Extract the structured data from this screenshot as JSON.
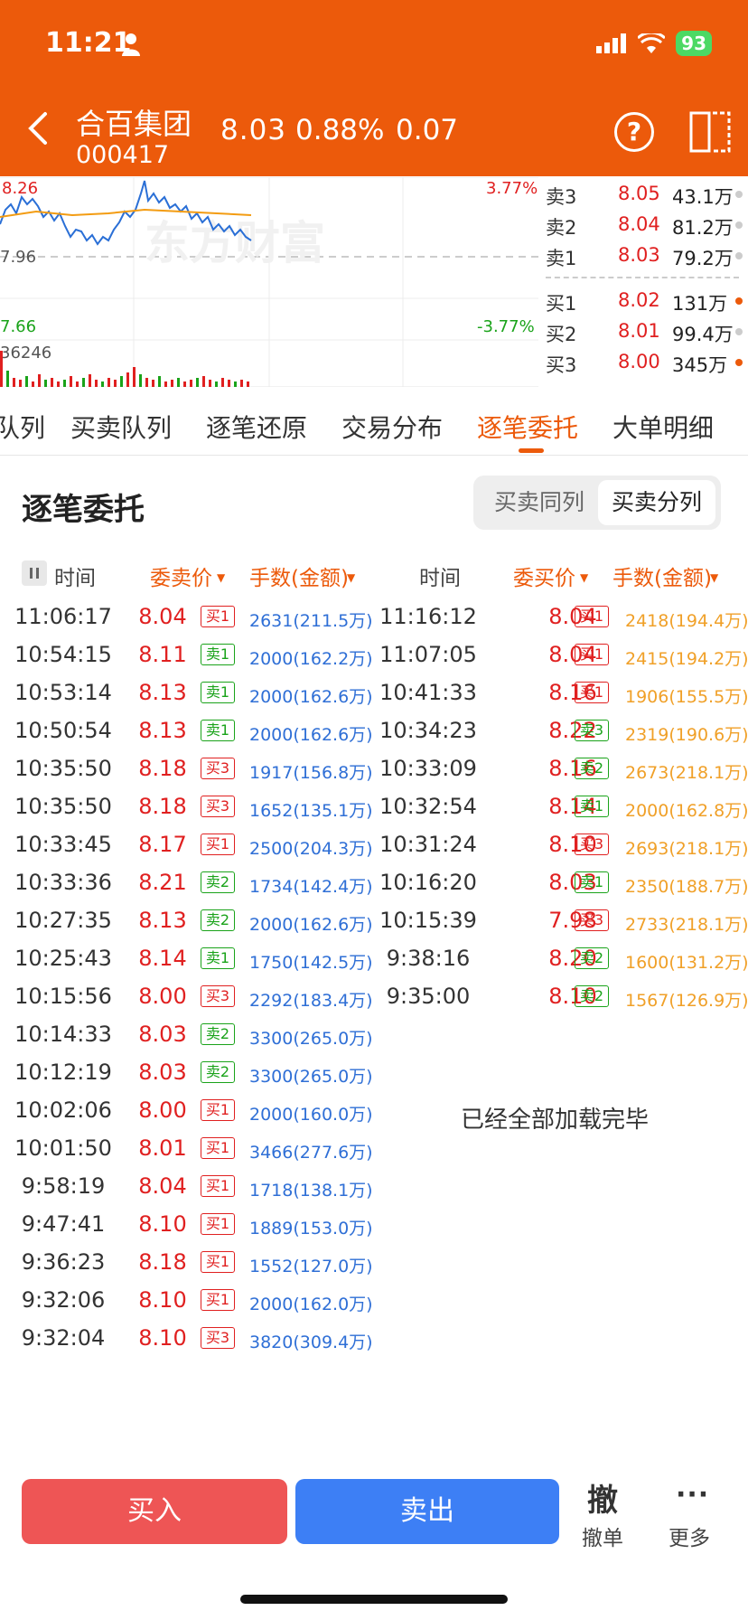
{
  "status": {
    "time": "11:21",
    "battery": "93"
  },
  "stock": {
    "name": "合百集团",
    "code": "000417",
    "price": "8.03",
    "pct": "0.88%",
    "change": "0.07"
  },
  "chart": {
    "high_label": "8.26",
    "mid_label": "7.96",
    "low_label": "7.66",
    "up_pct": "3.77%",
    "down_pct": "-3.77%",
    "volume_label": "36246",
    "watermark": "东方财富"
  },
  "depth": {
    "sells": [
      {
        "label": "卖3",
        "price": "8.05",
        "volume": "43.1万"
      },
      {
        "label": "卖2",
        "price": "8.04",
        "volume": "81.2万"
      },
      {
        "label": "卖1",
        "price": "8.03",
        "volume": "79.2万"
      }
    ],
    "buys": [
      {
        "label": "买1",
        "price": "8.02",
        "volume": "131万"
      },
      {
        "label": "买2",
        "price": "8.01",
        "volume": "99.4万"
      },
      {
        "label": "买3",
        "price": "8.00",
        "volume": "345万"
      }
    ]
  },
  "tabs": [
    "队列",
    "买卖队列",
    "逐笔还原",
    "交易分布",
    "逐笔委托",
    "大单明细"
  ],
  "section": {
    "title": "逐笔委托",
    "seg_same": "买卖同列",
    "seg_split": "买卖分列"
  },
  "columns": {
    "time": "时间",
    "sell_price": "委卖价",
    "amount": "手数(金额)",
    "time2": "时间",
    "buy_price": "委买价",
    "amount2": "手数(金额)"
  },
  "left_rows": [
    {
      "time": "11:06:17",
      "price": "8.04",
      "badge": "买1",
      "amount": "2631(211.5万)"
    },
    {
      "time": "10:54:15",
      "price": "8.11",
      "badge": "卖1",
      "amount": "2000(162.2万)"
    },
    {
      "time": "10:53:14",
      "price": "8.13",
      "badge": "卖1",
      "amount": "2000(162.6万)"
    },
    {
      "time": "10:50:54",
      "price": "8.13",
      "badge": "卖1",
      "amount": "2000(162.6万)"
    },
    {
      "time": "10:35:50",
      "price": "8.18",
      "badge": "买3",
      "amount": "1917(156.8万)"
    },
    {
      "time": "10:35:50",
      "price": "8.18",
      "badge": "买3",
      "amount": "1652(135.1万)"
    },
    {
      "time": "10:33:45",
      "price": "8.17",
      "badge": "买1",
      "amount": "2500(204.3万)"
    },
    {
      "time": "10:33:36",
      "price": "8.21",
      "badge": "卖2",
      "amount": "1734(142.4万)"
    },
    {
      "time": "10:27:35",
      "price": "8.13",
      "badge": "卖2",
      "amount": "2000(162.6万)"
    },
    {
      "time": "10:25:43",
      "price": "8.14",
      "badge": "卖1",
      "amount": "1750(142.5万)"
    },
    {
      "time": "10:15:56",
      "price": "8.00",
      "badge": "买3",
      "amount": "2292(183.4万)"
    },
    {
      "time": "10:14:33",
      "price": "8.03",
      "badge": "卖2",
      "amount": "3300(265.0万)"
    },
    {
      "time": "10:12:19",
      "price": "8.03",
      "badge": "卖2",
      "amount": "3300(265.0万)"
    },
    {
      "time": "10:02:06",
      "price": "8.00",
      "badge": "买1",
      "amount": "2000(160.0万)"
    },
    {
      "time": "10:01:50",
      "price": "8.01",
      "badge": "买1",
      "amount": "3466(277.6万)"
    },
    {
      "time": "9:58:19",
      "price": "8.04",
      "badge": "买1",
      "amount": "1718(138.1万)"
    },
    {
      "time": "9:47:41",
      "price": "8.10",
      "badge": "买1",
      "amount": "1889(153.0万)"
    },
    {
      "time": "9:36:23",
      "price": "8.18",
      "badge": "买1",
      "amount": "1552(127.0万)"
    },
    {
      "time": "9:32:06",
      "price": "8.10",
      "badge": "买1",
      "amount": "2000(162.0万)"
    },
    {
      "time": "9:32:04",
      "price": "8.10",
      "badge": "买3",
      "amount": "3820(309.4万)"
    }
  ],
  "right_rows": [
    {
      "time": "11:16:12",
      "price": "8.04",
      "badge": "买1",
      "amount": "2418(194.4万)"
    },
    {
      "time": "11:07:05",
      "price": "8.04",
      "badge": "买1",
      "amount": "2415(194.2万)"
    },
    {
      "time": "10:41:33",
      "price": "8.16",
      "badge": "买1",
      "amount": "1906(155.5万)"
    },
    {
      "time": "10:34:23",
      "price": "8.22",
      "badge": "卖3",
      "amount": "2319(190.6万)"
    },
    {
      "time": "10:33:09",
      "price": "8.16",
      "badge": "卖2",
      "amount": "2673(218.1万)"
    },
    {
      "time": "10:32:54",
      "price": "8.14",
      "badge": "卖1",
      "amount": "2000(162.8万)"
    },
    {
      "time": "10:31:24",
      "price": "8.10",
      "badge": "买3",
      "amount": "2693(218.1万)"
    },
    {
      "time": "10:16:20",
      "price": "8.03",
      "badge": "卖1",
      "amount": "2350(188.7万)"
    },
    {
      "time": "10:15:39",
      "price": "7.98",
      "badge": "买3",
      "amount": "2733(218.1万)"
    },
    {
      "time": "9:38:16",
      "price": "8.20",
      "badge": "卖2",
      "amount": "1600(131.2万)"
    },
    {
      "time": "9:35:00",
      "price": "8.10",
      "badge": "卖2",
      "amount": "1567(126.9万)"
    }
  ],
  "loaded_text": "已经全部加载完毕",
  "bottom": {
    "buy": "买入",
    "sell": "卖出",
    "cancel_icon": "撤",
    "cancel": "撤单",
    "more_icon": "···",
    "more": "更多"
  }
}
